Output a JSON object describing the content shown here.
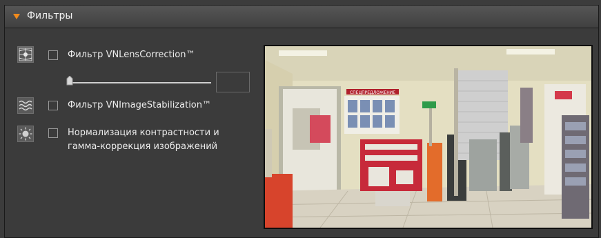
{
  "panel": {
    "title": "Фильтры",
    "expand_icon": "triangle-down-icon",
    "accent_color": "#f08a1c"
  },
  "filters": [
    {
      "icon": "lens-correction-icon",
      "label": "Фильтр VNLensCorrection™",
      "checked": false
    },
    {
      "icon": "stabilization-icon",
      "label": "Фильтр VNImageStabilization™",
      "checked": false
    },
    {
      "icon": "brightness-icon",
      "label_line1": "Нормализация контрастности и",
      "label_line2": "гамма-коррекция изображений",
      "checked": false
    }
  ],
  "lens_slider": {
    "value_fraction": 0.0,
    "value_text": ""
  },
  "preview": {
    "sign_text": "СПЕЦПРЕДЛОЖЕНИЕ"
  }
}
